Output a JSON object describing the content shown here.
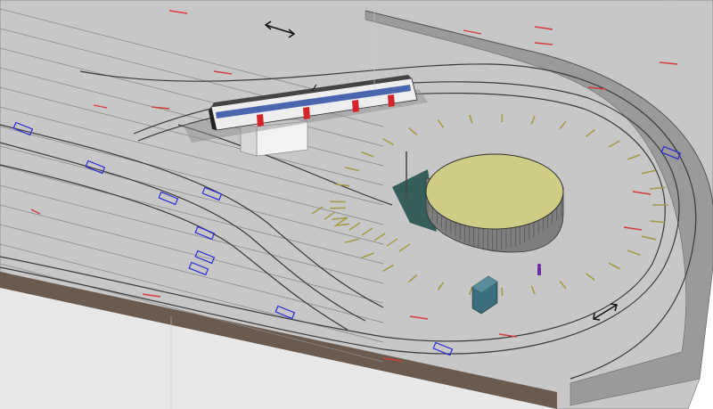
{
  "view": {
    "kind": "3D isometric CAD model of a tram terminus loop",
    "colors": {
      "background": "#ffffff",
      "deck": "#c7c7c7",
      "deck_edge": "#6b5a4e",
      "deck_side": "#e6e6e6",
      "track": "#3a3a3a",
      "guide_line": "#8a8a8a",
      "red_mark": "#d43a3a",
      "blue_mark": "#2a2ad8",
      "bay_line": "#a39a4a",
      "ring_roof": "#cfcc86",
      "ring_wall": "#7e7e7e",
      "shadow": "#355e5a",
      "retaining_wall": "#8c8c8c",
      "tram_body": "#eeeeee",
      "tram_red": "#d2242a",
      "tram_blue": "#2d4ea3",
      "tram_roof": "#444444",
      "van": "#3c6d7c",
      "person": "#6a2aa8"
    }
  },
  "objects": {
    "platform": "deck",
    "tram": "tram-vehicle",
    "shelter": "station-building",
    "rotunda": "circular-building",
    "van": "service-van",
    "pedestrian": "person-figure",
    "arrows": [
      "direction-arrow-top",
      "direction-arrow-right"
    ]
  }
}
